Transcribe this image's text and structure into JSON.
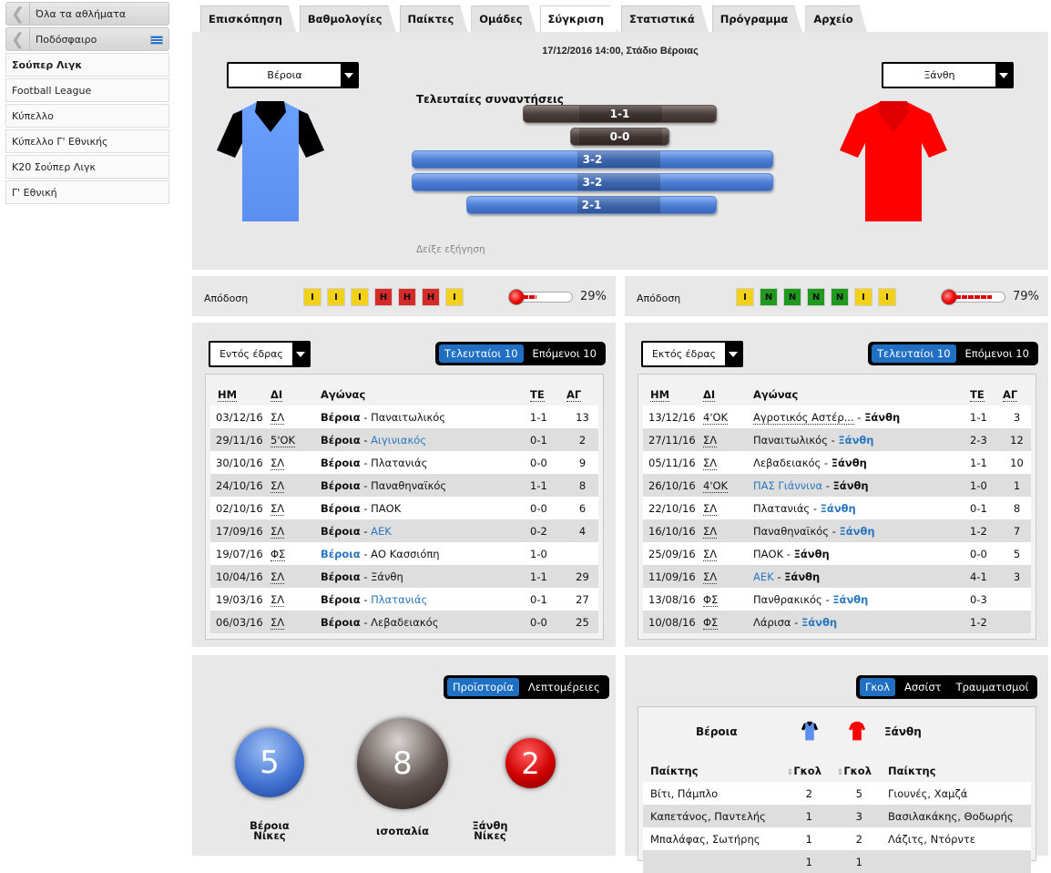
{
  "sidebar": {
    "back_items": [
      {
        "label": "Όλα τα αθλήματα"
      },
      {
        "label": "Ποδόσφαιρο"
      }
    ],
    "items": [
      {
        "label": "Σούπερ Λιγκ",
        "active": true
      },
      {
        "label": "Football League"
      },
      {
        "label": "Κύπελλο"
      },
      {
        "label": "Κύπελλο Γ' Εθνικής"
      },
      {
        "label": "K20 Σούπερ Λιγκ"
      },
      {
        "label": "Γ' Εθνική"
      }
    ]
  },
  "tabs": [
    {
      "label": "Επισκόπηση"
    },
    {
      "label": "Βαθμολογίες"
    },
    {
      "label": "Παίκτες"
    },
    {
      "label": "Ομάδες"
    },
    {
      "label": "Σύγκριση",
      "active": true
    },
    {
      "label": "Στατιστικά"
    },
    {
      "label": "Πρόγραμμα"
    },
    {
      "label": "Αρχείο"
    }
  ],
  "match": {
    "info": "17/12/2016 14:00, Στάδιο Βέροιας",
    "home_team": "Βέροια",
    "away_team": "Ξάνθη",
    "home_color": "#5b8ff0",
    "away_color": "#ff0000",
    "last_meetings_title": "Τελευταίες συναντήσεις",
    "last_meetings": [
      {
        "score": "1-1",
        "result": "draw"
      },
      {
        "score": "0-0",
        "result": "draw"
      },
      {
        "score": "3-2",
        "result": "home"
      },
      {
        "score": "3-2",
        "result": "home"
      },
      {
        "score": "2-1",
        "result": "home"
      }
    ],
    "explain_link": "Δείξε εξήγηση"
  },
  "form": {
    "label": "Απόδοση",
    "home": {
      "results": [
        "I",
        "I",
        "I",
        "H",
        "H",
        "H",
        "I"
      ],
      "percent": "29%",
      "value": 0.29
    },
    "away": {
      "results": [
        "I",
        "N",
        "N",
        "N",
        "N",
        "I",
        "I"
      ],
      "percent": "79%",
      "value": 0.79
    }
  },
  "recent": {
    "toggle": [
      "Τελευταίοι 10",
      "Επόμενοι 10"
    ],
    "columns": {
      "date": "ΗΜ",
      "comp": "ΔΙ",
      "match": "Αγώνας",
      "score": "ΤΕ",
      "round": "ΑΓ"
    },
    "home": {
      "filter": "Εντός έδρας",
      "rows": [
        {
          "date": "03/12/16",
          "comp": "ΣΛ",
          "team1": "Βέροια",
          "team2": "Παναιτωλικός",
          "score": "1-1",
          "round": "13",
          "win": ""
        },
        {
          "date": "29/11/16",
          "comp": "5'ΟΚ",
          "team1": "Βέροια",
          "team2": "Αιγινιακός",
          "score": "0-1",
          "round": "2",
          "win": "2"
        },
        {
          "date": "30/10/16",
          "comp": "ΣΛ",
          "team1": "Βέροια",
          "team2": "Πλατανιάς",
          "score": "0-0",
          "round": "9",
          "win": ""
        },
        {
          "date": "24/10/16",
          "comp": "ΣΛ",
          "team1": "Βέροια",
          "team2": "Παναθηναϊκός",
          "score": "1-1",
          "round": "8",
          "win": ""
        },
        {
          "date": "02/10/16",
          "comp": "ΣΛ",
          "team1": "Βέροια",
          "team2": "ΠΑΟΚ",
          "score": "0-0",
          "round": "6",
          "win": ""
        },
        {
          "date": "17/09/16",
          "comp": "ΣΛ",
          "team1": "Βέροια",
          "team2": "ΑΕΚ",
          "score": "0-2",
          "round": "4",
          "win": "2"
        },
        {
          "date": "19/07/16",
          "comp": "ΦΣ",
          "team1": "Βέροια",
          "team2": "ΑΟ Κασσιόπη",
          "score": "1-0",
          "round": "",
          "win": "1"
        },
        {
          "date": "10/04/16",
          "comp": "ΣΛ",
          "team1": "Βέροια",
          "team2": "Ξάνθη",
          "score": "1-1",
          "round": "29",
          "win": ""
        },
        {
          "date": "19/03/16",
          "comp": "ΣΛ",
          "team1": "Βέροια",
          "team2": "Πλατανιάς",
          "score": "0-1",
          "round": "27",
          "win": "2"
        },
        {
          "date": "06/03/16",
          "comp": "ΣΛ",
          "team1": "Βέροια",
          "team2": "Λεβαδειακός",
          "score": "0-0",
          "round": "25",
          "win": ""
        }
      ]
    },
    "away": {
      "filter": "Εκτός έδρας",
      "rows": [
        {
          "date": "13/12/16",
          "comp": "4'ΟΚ",
          "team1": "Αγροτικός Αστέρ...",
          "team2": "Ξάνθη",
          "score": "1-1",
          "round": "3",
          "win": ""
        },
        {
          "date": "27/11/16",
          "comp": "ΣΛ",
          "team1": "Παναιτωλικός",
          "team2": "Ξάνθη",
          "score": "2-3",
          "round": "12",
          "win": "2"
        },
        {
          "date": "05/11/16",
          "comp": "ΣΛ",
          "team1": "Λεβαδειακός",
          "team2": "Ξάνθη",
          "score": "1-1",
          "round": "10",
          "win": ""
        },
        {
          "date": "26/10/16",
          "comp": "4'ΟΚ",
          "team1": "ΠΑΣ Γιάννινα",
          "team2": "Ξάνθη",
          "score": "1-0",
          "round": "1",
          "win": "1"
        },
        {
          "date": "22/10/16",
          "comp": "ΣΛ",
          "team1": "Πλατανιάς",
          "team2": "Ξάνθη",
          "score": "0-1",
          "round": "8",
          "win": "2"
        },
        {
          "date": "16/10/16",
          "comp": "ΣΛ",
          "team1": "Παναθηναϊκός",
          "team2": "Ξάνθη",
          "score": "1-2",
          "round": "7",
          "win": "2"
        },
        {
          "date": "25/09/16",
          "comp": "ΣΛ",
          "team1": "ΠΑΟΚ",
          "team2": "Ξάνθη",
          "score": "0-0",
          "round": "5",
          "win": ""
        },
        {
          "date": "11/09/16",
          "comp": "ΣΛ",
          "team1": "ΑΕΚ",
          "team2": "Ξάνθη",
          "score": "4-1",
          "round": "3",
          "win": "1"
        },
        {
          "date": "13/08/16",
          "comp": "ΦΣ",
          "team1": "Πανθρακικός",
          "team2": "Ξάνθη",
          "score": "0-3",
          "round": "",
          "win": "2"
        },
        {
          "date": "10/08/16",
          "comp": "ΦΣ",
          "team1": "Λάρισα",
          "team2": "Ξάνθη",
          "score": "1-2",
          "round": "",
          "win": "2"
        }
      ]
    }
  },
  "history": {
    "toggle": [
      "Προϊστορία",
      "Λεπτομέρειες"
    ],
    "home_wins": "5",
    "draws": "8",
    "away_wins": "2",
    "home_label_1": "Βέροια",
    "home_label_2": "Νίκες",
    "draw_label": "ισοπαλία",
    "away_label_1": "Ξάνθη",
    "away_label_2": "Νίκες"
  },
  "scorers": {
    "toggle": [
      "Γκολ",
      "Ασσίστ",
      "Τραυματισμοί"
    ],
    "home_team": "Βέροια",
    "away_team": "Ξάνθη",
    "col_player": "Παίκτης",
    "col_goals": "Γκολ",
    "rows": [
      {
        "home_player": "Βίτι, Πάμπλο",
        "home_goals": "2",
        "away_goals": "5",
        "away_player": "Γιουνές, Χαμζά"
      },
      {
        "home_player": "Καπετάνος, Παντελής",
        "home_goals": "1",
        "away_goals": "3",
        "away_player": "Βασιλακάκης, Θοδωρής"
      },
      {
        "home_player": "Μπαλάφας, Σωτήρης",
        "home_goals": "1",
        "away_goals": "2",
        "away_player": "Λάζιτς, Ντόρντε"
      },
      {
        "home_player": "",
        "home_goals": "1",
        "away_goals": "1",
        "away_player": ""
      }
    ]
  }
}
